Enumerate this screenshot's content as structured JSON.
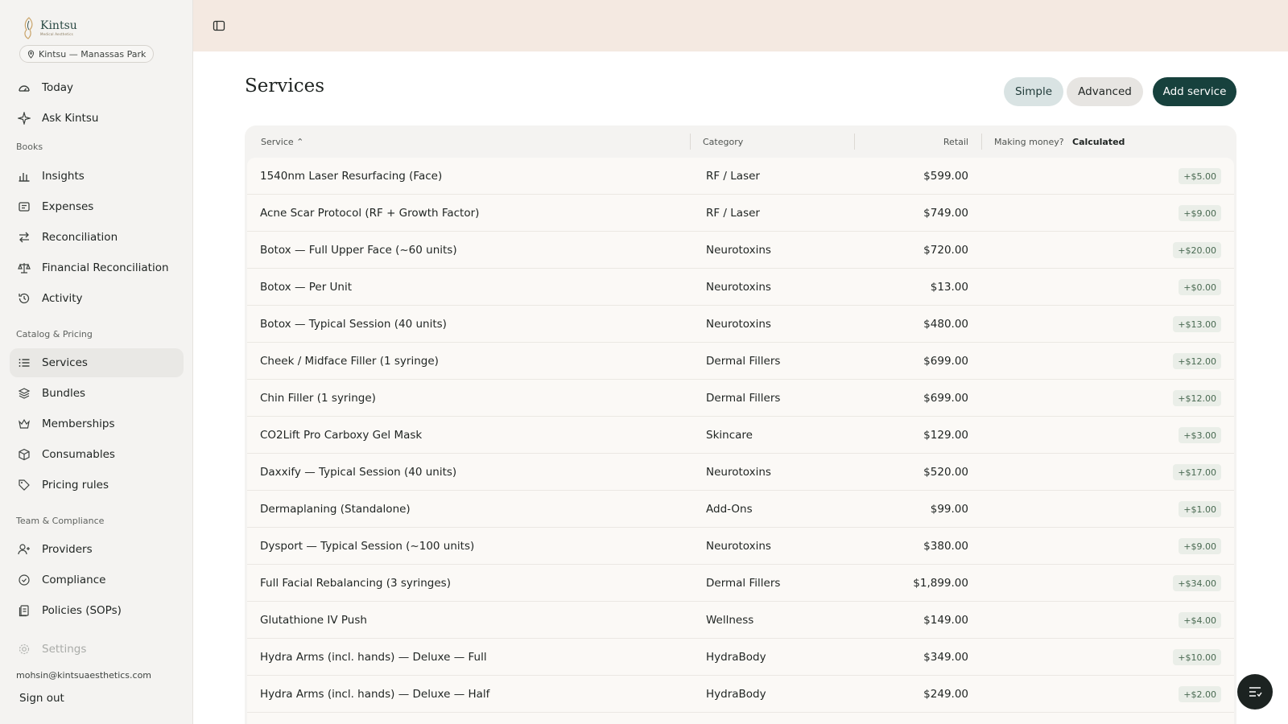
{
  "brand": {
    "name": "Kintsu",
    "tagline": "Medical Aesthetics"
  },
  "location": {
    "label": "Kintsu — Manassas Park"
  },
  "nav": {
    "today": "Today",
    "ask": "Ask Kintsu",
    "books_label": "Books",
    "insights": "Insights",
    "expenses": "Expenses",
    "reconciliation": "Reconciliation",
    "financial_reconciliation": "Financial Reconciliation",
    "activity": "Activity",
    "catalog_label": "Catalog & Pricing",
    "services": "Services",
    "bundles": "Bundles",
    "memberships": "Memberships",
    "consumables": "Consumables",
    "pricing_rules": "Pricing rules",
    "team_label": "Team & Compliance",
    "providers": "Providers",
    "compliance": "Compliance",
    "policies": "Policies (SOPs)",
    "settings": "Settings"
  },
  "user": {
    "email": "mohsin@kintsuaesthetics.com",
    "signout": "Sign out"
  },
  "page": {
    "title": "Services",
    "simple_label": "Simple",
    "advanced_label": "Advanced",
    "add_label": "Add service"
  },
  "table": {
    "headers": {
      "service": "Service",
      "category": "Category",
      "retail": "Retail",
      "making_money": "Making money?",
      "calculated": "Calculated"
    },
    "rows": [
      {
        "name": "1540nm Laser Resurfacing (Face)",
        "category": "RF / Laser",
        "retail": "$599.00",
        "margin": "+$5.00"
      },
      {
        "name": "Acne Scar Protocol (RF + Growth Factor)",
        "category": "RF / Laser",
        "retail": "$749.00",
        "margin": "+$9.00"
      },
      {
        "name": "Botox — Full Upper Face (~60 units)",
        "category": "Neurotoxins",
        "retail": "$720.00",
        "margin": "+$20.00"
      },
      {
        "name": "Botox — Per Unit",
        "category": "Neurotoxins",
        "retail": "$13.00",
        "margin": "+$0.00"
      },
      {
        "name": "Botox — Typical Session (40 units)",
        "category": "Neurotoxins",
        "retail": "$480.00",
        "margin": "+$13.00"
      },
      {
        "name": "Cheek / Midface Filler (1 syringe)",
        "category": "Dermal Fillers",
        "retail": "$699.00",
        "margin": "+$12.00"
      },
      {
        "name": "Chin Filler (1 syringe)",
        "category": "Dermal Fillers",
        "retail": "$699.00",
        "margin": "+$12.00"
      },
      {
        "name": "CO2Lift Pro Carboxy Gel Mask",
        "category": "Skincare",
        "retail": "$129.00",
        "margin": "+$3.00"
      },
      {
        "name": "Daxxify — Typical Session (40 units)",
        "category": "Neurotoxins",
        "retail": "$520.00",
        "margin": "+$17.00"
      },
      {
        "name": "Dermaplaning (Standalone)",
        "category": "Add-Ons",
        "retail": "$99.00",
        "margin": "+$1.00"
      },
      {
        "name": "Dysport — Typical Session (~100 units)",
        "category": "Neurotoxins",
        "retail": "$380.00",
        "margin": "+$9.00"
      },
      {
        "name": "Full Facial Rebalancing (3 syringes)",
        "category": "Dermal Fillers",
        "retail": "$1,899.00",
        "margin": "+$34.00"
      },
      {
        "name": "Glutathione IV Push",
        "category": "Wellness",
        "retail": "$149.00",
        "margin": "+$4.00"
      },
      {
        "name": "Hydra Arms (incl. hands) — Deluxe — Full",
        "category": "HydraBody",
        "retail": "$349.00",
        "margin": "+$10.00"
      },
      {
        "name": "Hydra Arms (incl. hands) — Deluxe — Half",
        "category": "HydraBody",
        "retail": "$249.00",
        "margin": "+$2.00"
      },
      {
        "name": "",
        "category": "",
        "retail": "",
        "margin": ""
      }
    ]
  },
  "colors": {
    "accent": "#17413d",
    "topbar": "#f4e9e1",
    "sidebar": "#f4f3f1",
    "margin_pill": "#eaeee8"
  }
}
